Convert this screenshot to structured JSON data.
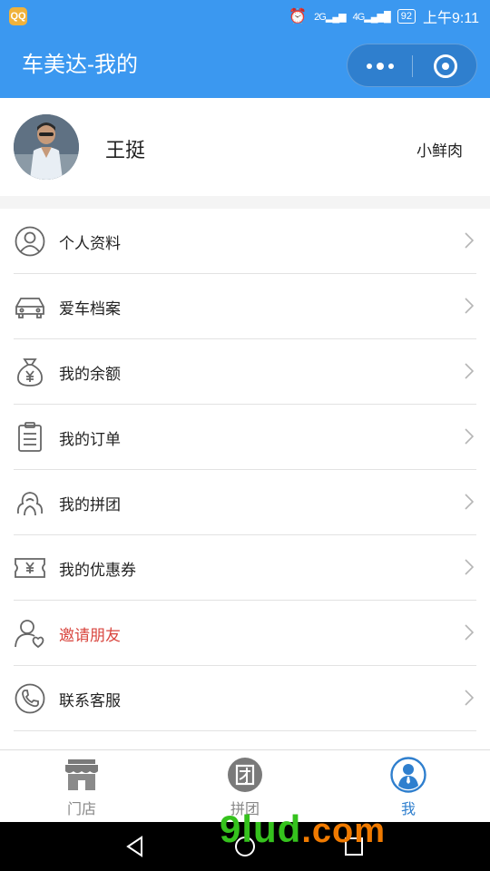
{
  "status_bar": {
    "app_badge": "QQ",
    "network_1": "2G",
    "network_2": "4G",
    "battery": "92",
    "time": "上午9:11"
  },
  "title_bar": {
    "title": "车美达-我的"
  },
  "profile": {
    "name": "王挺",
    "tag": "小鲜肉"
  },
  "menu": {
    "items": [
      {
        "label": "个人资料",
        "icon": "user-icon",
        "color": "#222222"
      },
      {
        "label": "爱车档案",
        "icon": "car-icon",
        "color": "#222222"
      },
      {
        "label": "我的余额",
        "icon": "money-bag-icon",
        "color": "#222222"
      },
      {
        "label": "我的订单",
        "icon": "clipboard-icon",
        "color": "#222222"
      },
      {
        "label": "我的拼团",
        "icon": "group-icon",
        "color": "#222222"
      },
      {
        "label": "我的优惠券",
        "icon": "coupon-icon",
        "color": "#222222"
      },
      {
        "label": "邀请朋友",
        "icon": "invite-friend-icon",
        "color": "#d9463f"
      },
      {
        "label": "联系客服",
        "icon": "phone-icon",
        "color": "#222222"
      }
    ]
  },
  "tab_bar": {
    "tabs": [
      {
        "label": "门店",
        "icon": "store-icon",
        "active": false
      },
      {
        "label": "拼团",
        "icon": "group-buy-icon",
        "active": false
      },
      {
        "label": "我",
        "icon": "profile-icon",
        "active": true
      }
    ]
  },
  "watermark": {
    "main": "9lud",
    "domain": ".com"
  },
  "colors": {
    "primary": "#3b98f0",
    "accent_text": "#2f7fce",
    "danger_text": "#d9463f"
  }
}
